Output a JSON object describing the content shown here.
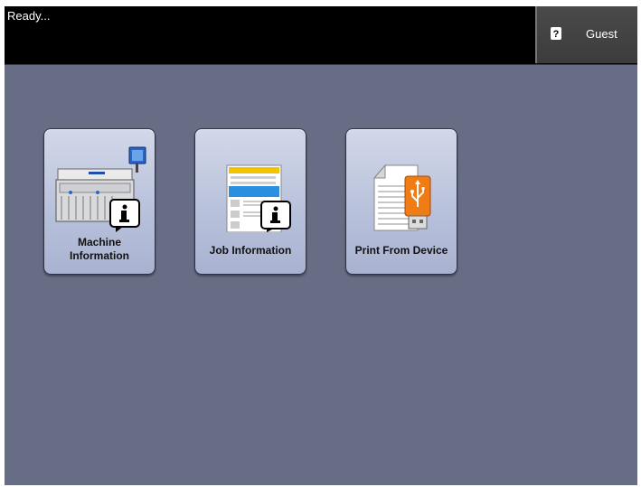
{
  "status": {
    "text": "Ready..."
  },
  "user": {
    "label": "Guest",
    "icon": "user-lock-icon"
  },
  "tiles": [
    {
      "label": "Machine\nInformation",
      "icon": "printer-info-icon"
    },
    {
      "label": "Job Information",
      "icon": "document-info-icon"
    },
    {
      "label": "Print From Device",
      "icon": "usb-document-icon"
    }
  ],
  "colors": {
    "background": "#686d86",
    "topbar": "#000000",
    "tile": "#c4cbe2",
    "usb": "#ef7c14"
  }
}
